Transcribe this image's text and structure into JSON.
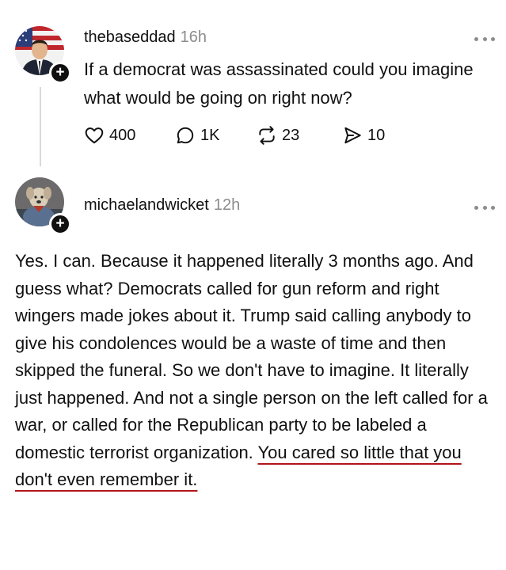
{
  "posts": [
    {
      "username": "thebaseddad",
      "time": "16h",
      "text": "If a democrat was assassinated could you imagine what would be going on right now?",
      "avatar": "flag-man-avatar",
      "stats": {
        "likes": "400",
        "replies": "1K",
        "reposts": "23",
        "shares": "10"
      }
    },
    {
      "username": "michaelandwicket",
      "time": "12h",
      "avatar": "dog-avatar",
      "text_plain": "Yes. I can. Because it happened literally 3 months ago. And guess what? Democrats called for gun reform and right wingers made jokes about it. Trump said calling anybody to give his condolences would be a waste of time and then skipped the funeral. So we don't have to imagine. It literally just happened. And not a single person on the left called for a war, or called for the Republican party to be labeled a domestic terrorist organization. ",
      "text_underlined": "You cared so little that you don't even remember it."
    }
  ],
  "colors": {
    "underline": "#b3141a",
    "muted": "#8c8c8c",
    "text": "#101010"
  },
  "icons": {
    "like": "heart-icon",
    "reply": "comment-icon",
    "repost": "repost-icon",
    "share": "send-icon",
    "more": "more-dots-icon",
    "follow": "plus-icon"
  }
}
